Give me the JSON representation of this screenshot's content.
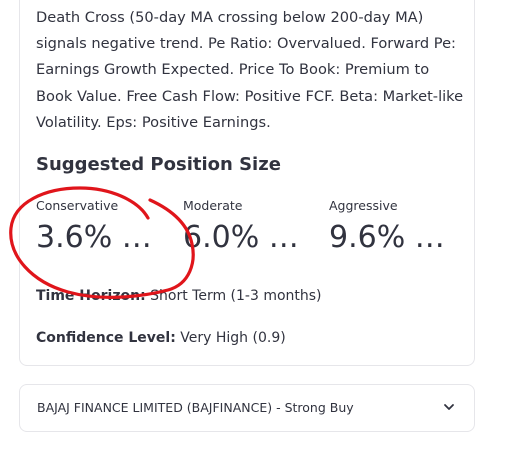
{
  "analysis": {
    "text": "Death Cross (50-day MA crossing below 200-day MA) signals negative trend. Pe Ratio: Overvalued. Forward Pe: Earnings Growth Expected. Price To Book: Premium to Book Value. Free Cash Flow: Positive FCF. Beta: Market-like Volatility. Eps: Positive Earnings."
  },
  "position_size": {
    "title": "Suggested Position Size",
    "metrics": [
      {
        "label": "Conservative",
        "value": "3.6% …"
      },
      {
        "label": "Moderate",
        "value": "6.0% …"
      },
      {
        "label": "Aggressive",
        "value": "9.6% …"
      }
    ]
  },
  "time_horizon": {
    "label": "Time Horizon:",
    "value": " Short Term (1-3 months)"
  },
  "confidence": {
    "label": "Confidence Level:",
    "value": " Very High (0.9)"
  },
  "expander": {
    "label": "BAJAJ FINANCE LIMITED (BAJFINANCE) - Strong Buy",
    "icon": "chevron-down-icon"
  },
  "colors": {
    "text": "#31333f",
    "border": "#e6e6ea",
    "annotation": "#e0151b"
  }
}
